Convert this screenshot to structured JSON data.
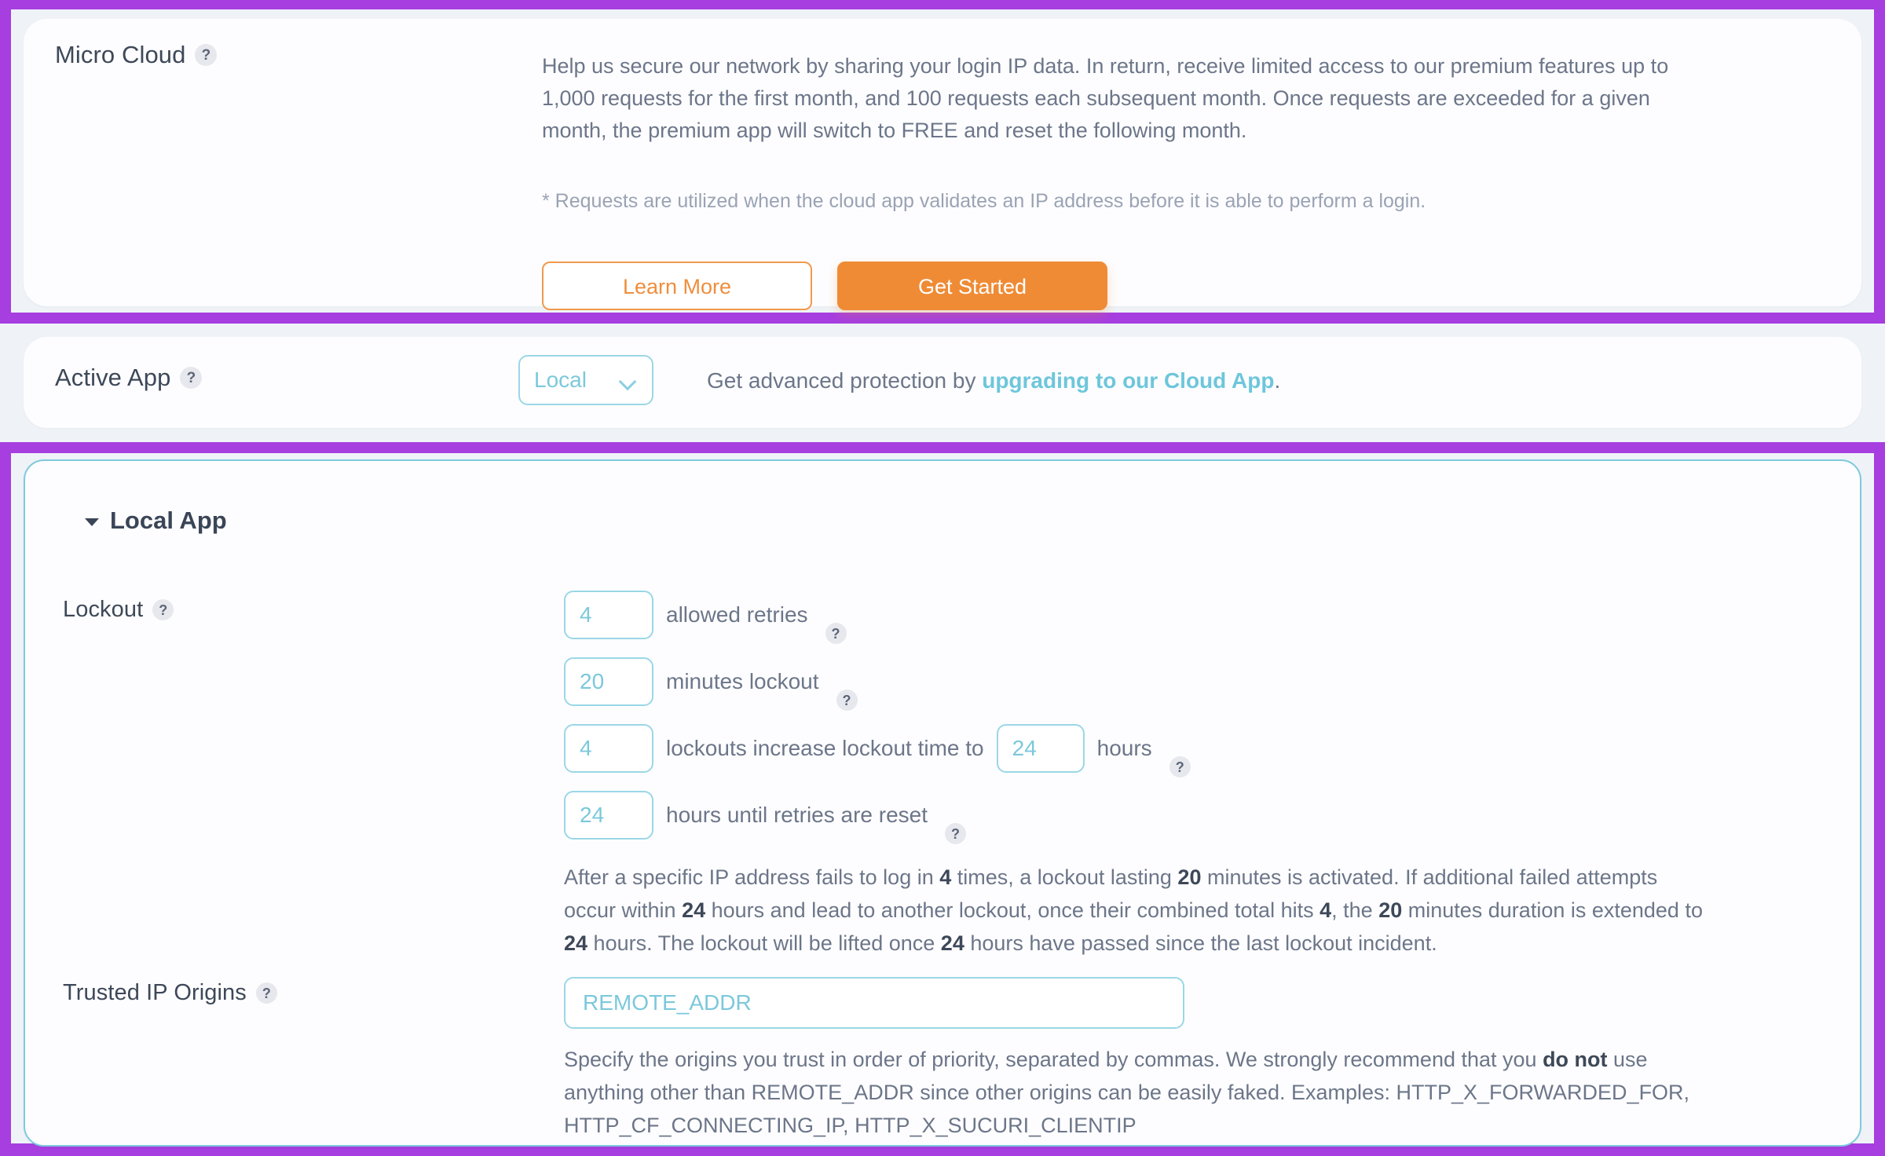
{
  "colors": {
    "highlight": "#a63ee0",
    "accent_orange": "#ef8b35",
    "accent_cyan": "#7cc8dc",
    "link_cyan": "#6ec6db"
  },
  "micro_cloud": {
    "label": "Micro Cloud",
    "help_icon": "question-mark-icon",
    "help_glyph": "?",
    "description": "Help us secure our network by sharing your login IP data. In return, receive limited access to our premium features up to 1,000 requests for the first month, and 100 requests each subsequent month. Once requests are exceeded for a given month, the premium app will switch to FREE and reset the following month.",
    "note": "* Requests are utilized when the cloud app validates an IP address before it is able to perform a login.",
    "learn_more_label": "Learn More",
    "get_started_label": "Get Started"
  },
  "active_app": {
    "label": "Active App",
    "help_glyph": "?",
    "selected_value": "Local",
    "options": [
      "Local"
    ],
    "chevron_icon": "chevron-down-icon",
    "upgrade_prefix": "Get advanced protection by ",
    "upgrade_link": "upgrading to our Cloud App",
    "upgrade_suffix": "."
  },
  "local_app": {
    "title": "Local App",
    "caret_icon": "caret-down-icon",
    "lockout": {
      "label": "Lockout",
      "help_glyph": "?",
      "rows": [
        {
          "value": "4",
          "label": "allowed retries",
          "help_glyph": "?"
        },
        {
          "value": "20",
          "label": "minutes lockout",
          "help_glyph": "?"
        },
        {
          "value": "4",
          "label": "lockouts increase lockout time to",
          "value2": "24",
          "label2": "hours",
          "help_glyph": "?"
        },
        {
          "value": "24",
          "label": "hours until retries are reset",
          "help_glyph": "?"
        }
      ],
      "description_parts": [
        {
          "t": "After a specific IP address fails to log in ",
          "b": false
        },
        {
          "t": "4",
          "b": true
        },
        {
          "t": " times, a lockout lasting ",
          "b": false
        },
        {
          "t": "20",
          "b": true
        },
        {
          "t": " minutes is activated. If additional failed attempts occur within ",
          "b": false
        },
        {
          "t": "24",
          "b": true
        },
        {
          "t": " hours and lead to another lockout, once their combined total hits ",
          "b": false
        },
        {
          "t": "4",
          "b": true
        },
        {
          "t": ", the ",
          "b": false
        },
        {
          "t": "20",
          "b": true
        },
        {
          "t": " minutes duration is extended to ",
          "b": false
        },
        {
          "t": "24",
          "b": true
        },
        {
          "t": " hours. The lockout will be lifted once ",
          "b": false
        },
        {
          "t": "24",
          "b": true
        },
        {
          "t": " hours have passed since the last lockout incident.",
          "b": false
        }
      ]
    },
    "trusted_ip_origins": {
      "label": "Trusted IP Origins",
      "help_glyph": "?",
      "input_value": "REMOTE_ADDR",
      "input_placeholder": "REMOTE_ADDR",
      "description_parts": [
        {
          "t": "Specify the origins you trust in order of priority, separated by commas. We strongly recommend that you ",
          "b": false
        },
        {
          "t": "do not",
          "b": true
        },
        {
          "t": " use anything other than REMOTE_ADDR since other origins can be easily faked. Examples: HTTP_X_FORWARDED_FOR, HTTP_CF_CONNECTING_IP, HTTP_X_SUCURI_CLIENTIP",
          "b": false
        }
      ]
    }
  }
}
